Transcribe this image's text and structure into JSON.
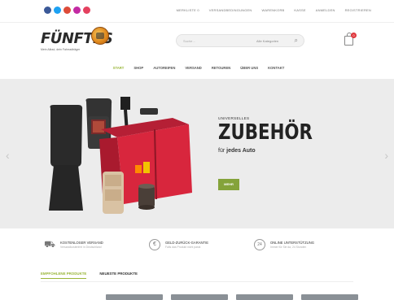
{
  "colors": {
    "accent": "#9ab63a",
    "button": "#84a33a",
    "hero_bg": "#ececec",
    "social": [
      "#3b5998",
      "#1da1f2",
      "#dd4b39",
      "#c32aa3",
      "#e4405f"
    ]
  },
  "topbar": {
    "social_icons": [
      "facebook-icon",
      "twitter-icon",
      "google-plus-icon",
      "instagram-icon",
      "pinterest-icon"
    ],
    "links": [
      "Merkliste 0",
      "Versandbedingungen",
      "Warenkorb",
      "Kasse",
      "Anmelden",
      "Registrieren"
    ]
  },
  "header": {
    "logo_text": "FÜNFTES",
    "logo_tagline": "Mein Allrad, dein Fahrradträger",
    "search_placeholder": "Suche…",
    "search_category": "Alle Kategorien",
    "cart_count": "0"
  },
  "nav": [
    "Start",
    "Shop",
    "Autoreifen",
    "Versand",
    "Retouren",
    "Über uns",
    "Kontakt"
  ],
  "hero": {
    "kicker": "Universelles",
    "headline": "ZUBEHÖR",
    "sub_prefix": "für",
    "sub_bold": "jedes Auto",
    "button": "Mehr"
  },
  "features": [
    {
      "icon": "truck-icon",
      "title": "Kostenloser Versand",
      "desc": "Versandkostenfrei in Deutschland"
    },
    {
      "icon": "euro-icon",
      "title": "Geld-zurück-Garantie",
      "desc": "Falls das Produkt nicht passt"
    },
    {
      "icon": "clock-24-icon",
      "title": "Online Unterstützung",
      "desc": "Immer für Sie da, 24 Stunden"
    }
  ],
  "tabs": [
    "Empfohlene Produkte",
    "Neueste Produkte"
  ]
}
